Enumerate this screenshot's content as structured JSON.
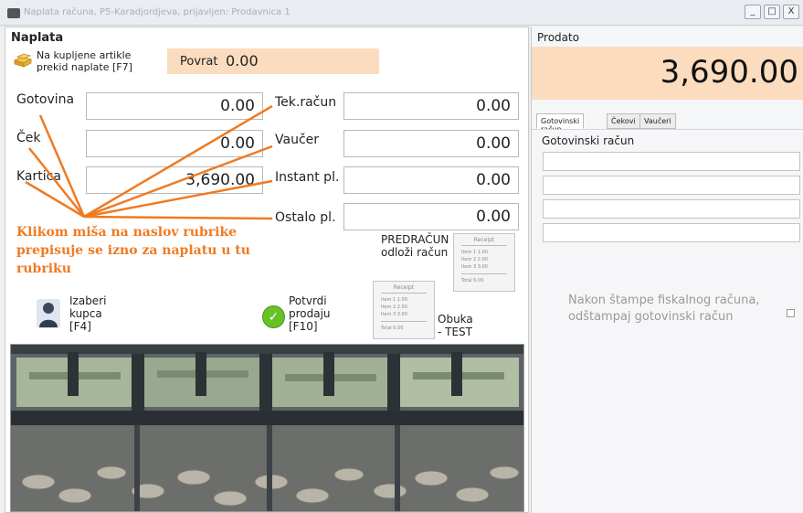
{
  "window": {
    "title": "Naplata računa, P5-Karadjordjeva, prijavljen: Prodavnica 1",
    "controls": [
      "_",
      "□",
      "X"
    ]
  },
  "left_panel": {
    "heading": "Naplata",
    "gold_icon": "gold-bars-icon",
    "link_lines": [
      "Na kupljene artikle",
      "prekid naplate [F7]"
    ],
    "povrat_label": "Povrat",
    "povrat_value": "0.00",
    "fields_left": [
      {
        "label": "Gotovina",
        "value": "0.00"
      },
      {
        "label": "Ček",
        "value": "0.00"
      },
      {
        "label": "Kartica",
        "value": "3,690.00"
      }
    ],
    "fields_right": [
      {
        "label": "Tek.račun",
        "value": "0.00"
      },
      {
        "label": "Vaučer",
        "value": "0.00"
      },
      {
        "label": "Instant pl.",
        "value": "0.00"
      },
      {
        "label": "Ostalo pl.",
        "value": "0.00"
      }
    ],
    "annotation": "Klikom miša na naslov rubrike prepisuje se izno za naplatu u tu rubriku",
    "annotation_color": "#f07a22",
    "predracun_lines": [
      "PREDRAČUN",
      "odloži račun"
    ],
    "receipt": {
      "header": "Receipt",
      "rows": [
        "Item 1   1.00",
        "Item 2   2.00",
        "Item 3   3.00"
      ],
      "total": "Total   6.00"
    },
    "izaberi_lines": [
      "Izaberi",
      "kupca",
      "[F4]"
    ],
    "potvrdi_lines": [
      "Potvrdi",
      "prodaju",
      "[F10]"
    ],
    "obuka_lines": [
      "Obuka",
      "- TEST"
    ],
    "photo_icon": "cash-drawer-photo"
  },
  "right_panel": {
    "prodato_label": "Prodato",
    "prodato_value": "3,690.00",
    "accent": "#fcdcbf",
    "tabs": [
      "Gotovinski račun",
      "Čekovi",
      "Vaučeri"
    ],
    "tab_title": "Gotovinski račun",
    "note_lines": [
      "Nakon štampe fiskalnog računa,",
      "odštampaj gotovinski račun"
    ]
  }
}
